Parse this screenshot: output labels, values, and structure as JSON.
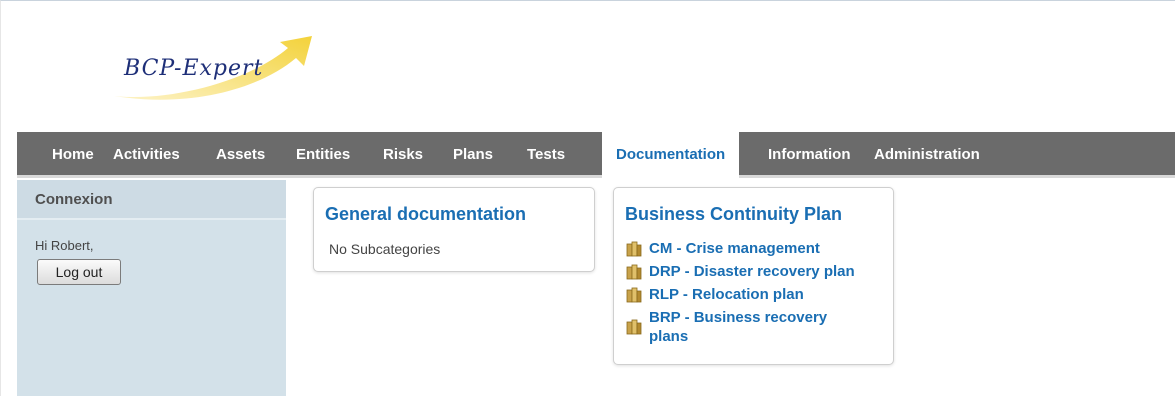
{
  "brand": {
    "logo_text": "BCP-Expert"
  },
  "nav": {
    "items": [
      "Home",
      "Activities",
      "Assets",
      "Entities",
      "Risks",
      "Plans",
      "Tests",
      "Documentation",
      "Information",
      "Administration"
    ],
    "active": "Documentation"
  },
  "sidebar": {
    "header": "Connexion",
    "greeting": "Hi Robert,",
    "logout_label": "Log out"
  },
  "general_doc": {
    "title": "General documentation",
    "empty_text": "No Subcategories"
  },
  "bcp": {
    "title": "Business Continuity Plan",
    "items": [
      "CM - Crise management",
      "DRP - Disaster recovery plan",
      "RLP - Relocation plan",
      "BRP - Business recovery plans"
    ]
  },
  "colors": {
    "nav_bg": "#6b6b6b",
    "link": "#1a6eb3",
    "sidebar_bg": "#d3e1e9",
    "logo_arrow": "#f5d94a",
    "logo_text": "#1e2f78"
  },
  "icons": {
    "doc_item": "folder-icon",
    "logo": "swoosh-arrow-icon"
  }
}
